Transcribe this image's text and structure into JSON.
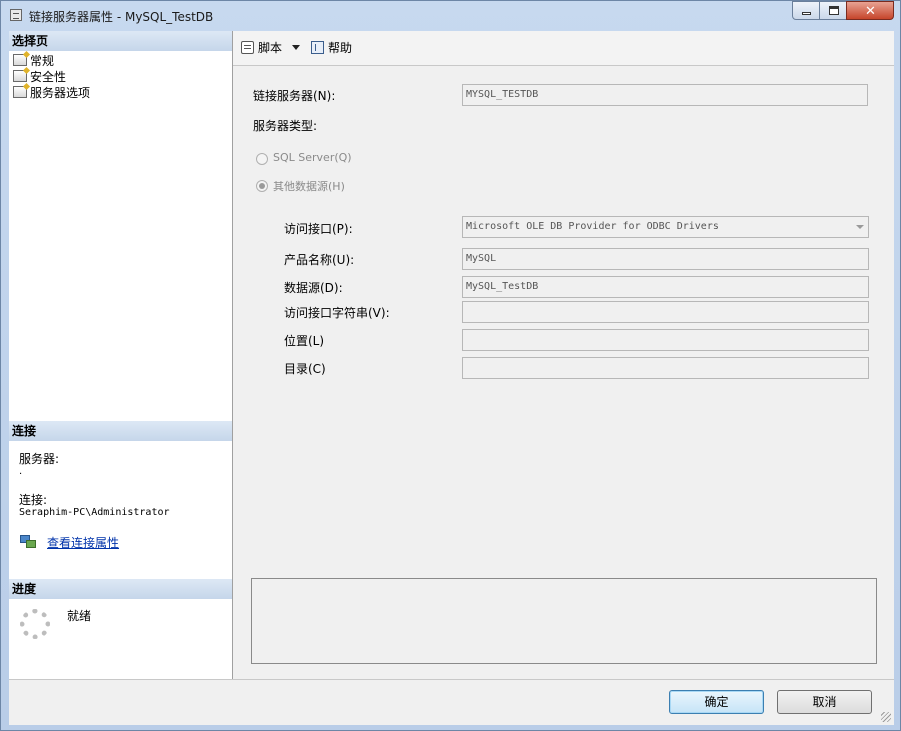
{
  "window": {
    "title": "链接服务器属性 - MySQL_TestDB",
    "icon": "server-icon"
  },
  "left_pane": {
    "select_page_header": "选择页",
    "pages": [
      {
        "label": "常规",
        "icon": "page-icon"
      },
      {
        "label": "安全性",
        "icon": "page-icon"
      },
      {
        "label": "服务器选项",
        "icon": "page-icon"
      }
    ],
    "connection_header": "连接",
    "server_label": "服务器:",
    "server_value": ".",
    "connection_label": "连接:",
    "connection_value": "Seraphim-PC\\Administrator",
    "view_connection_link": "查看连接属性",
    "progress_header": "进度",
    "progress_status": "就绪"
  },
  "toolbar": {
    "script_label": "脚本",
    "help_label": "帮助"
  },
  "form": {
    "linked_server_label": "链接服务器(N):",
    "linked_server_value": "MYSQL_TESTDB",
    "server_type_label": "服务器类型:",
    "radio_sql_server": "SQL Server(Q)",
    "radio_other": "其他数据源(H)",
    "radio_other_selected": true,
    "provider_label": "访问接口(P):",
    "provider_value": "Microsoft OLE DB Provider for ODBC Drivers",
    "product_name_label": "产品名称(U):",
    "product_name_value": "MySQL",
    "data_source_label": "数据源(D):",
    "data_source_value": "MySQL_TestDB",
    "provider_string_label": "访问接口字符串(V):",
    "provider_string_value": "",
    "location_label": "位置(L)",
    "location_value": "",
    "catalog_label": "目录(C)",
    "catalog_value": ""
  },
  "buttons": {
    "ok": "确定",
    "cancel": "取消"
  },
  "colors": {
    "title_bar": "#c7d9ef",
    "section_header": "#c5d6ea",
    "link": "#0033aa",
    "close_button": "#c6452b"
  }
}
